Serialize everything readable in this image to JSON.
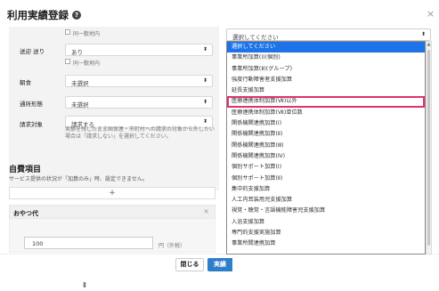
{
  "modal": {
    "title": "利用実績登録",
    "close_icon": "×"
  },
  "form": {
    "same_building_top": "同一敷地内",
    "pickup": {
      "label": "送迎 送り",
      "value": "あり",
      "same_building": "同一敷地内"
    },
    "meal": {
      "label": "朝食",
      "value": "未選択"
    },
    "bath": {
      "label": "通所形態",
      "value": "未選択"
    },
    "billing": {
      "label": "請求対象",
      "value": "請求する",
      "note": "実績を残したまま国保連・市町村への請求の対象から外したい場合は「請求しない」を選択してください。"
    }
  },
  "self_pay": {
    "title": "自費項目",
    "note": "サービス提供の状況が「加算のみ」時、設定できません。",
    "add_label": "+",
    "item": {
      "title": "おやつ代",
      "close_icon": "×",
      "price": "100",
      "unit": "円（外税）"
    }
  },
  "footer": {
    "cancel_label": "閉じる",
    "submit_label": "実績"
  },
  "addition": {
    "selected_value": "選択してください",
    "options": [
      "選択してください",
      "事業所加算(Ⅰ)(個別)",
      "事業所加算(Ⅱ)(グループ)",
      "強度行動障害者支援加算",
      "延長支援加算",
      "医療連携体制加算(Ⅶ)以外",
      "医療連携体制加算(Ⅶ)単位数",
      "関係機関連携加算(Ⅰ)",
      "関係機関連携加算(Ⅱ)",
      "関係機関連携加算(Ⅲ)",
      "関係機関連携加算(Ⅳ)",
      "個別サポート加算(Ⅰ)",
      "個別サポート加算(Ⅱ)",
      "集中的支援加算",
      "人工内耳装用児支援加算",
      "視覚・聴覚・言語機能障害児支援加算",
      "入浴支援加算",
      "専門的支援実施加算",
      "事業所間連携加算"
    ],
    "selected_index": 0,
    "highlighted_index": 5
  },
  "colors": {
    "selected_bg": "#1e73e8",
    "highlight_outline": "#e0336a",
    "primary_button": "#2e7ec9"
  },
  "icons": {
    "help": "help-circle-icon",
    "close": "close-icon",
    "caret": "chevron-updown-icon",
    "scroll_up": "scroll-up-arrow-icon"
  }
}
